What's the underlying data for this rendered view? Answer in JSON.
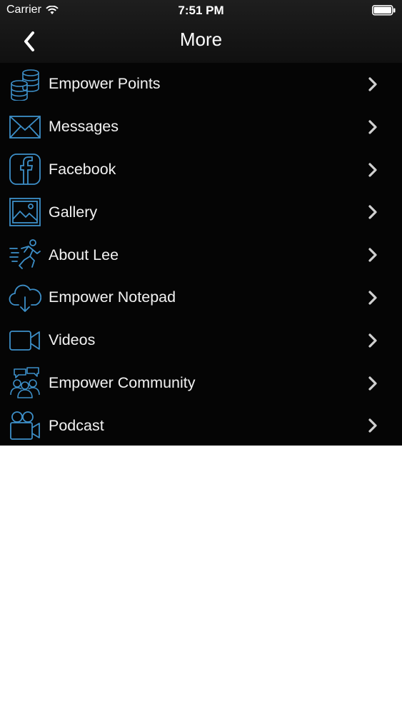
{
  "status_bar": {
    "carrier": "Carrier",
    "time": "7:51 PM",
    "icons": [
      "wifi-icon",
      "battery-icon"
    ]
  },
  "nav": {
    "title": "More",
    "back_icon": "chevron-left-icon"
  },
  "colors": {
    "background": "#050505",
    "icon_accent": "#3d8fc8",
    "text": "#f2f2f2",
    "chevron": "#d0d0d0"
  },
  "menu": {
    "items": [
      {
        "label": "Empower Points",
        "icon": "coins-stack-icon"
      },
      {
        "label": "Messages",
        "icon": "envelope-icon"
      },
      {
        "label": "Facebook",
        "icon": "facebook-icon"
      },
      {
        "label": "Gallery",
        "icon": "image-icon"
      },
      {
        "label": "About Lee",
        "icon": "running-person-icon"
      },
      {
        "label": "Empower Notepad",
        "icon": "cloud-download-icon"
      },
      {
        "label": "Videos",
        "icon": "video-camera-icon"
      },
      {
        "label": "Empower Community",
        "icon": "community-icon"
      },
      {
        "label": "Podcast",
        "icon": "movie-camera-icon"
      }
    ]
  }
}
